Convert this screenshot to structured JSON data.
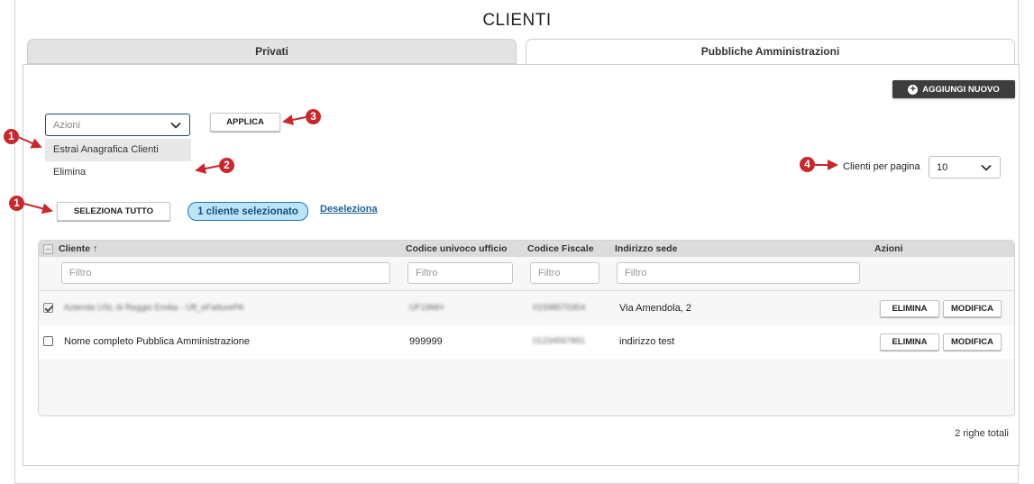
{
  "page": {
    "title": "CLIENTI"
  },
  "tabs": [
    {
      "label": "Privati",
      "active": false
    },
    {
      "label": "Pubbliche Amministrazioni",
      "active": true
    }
  ],
  "toolbar": {
    "add_new_label": "AGGIUNGI NUOVO",
    "add_icon": "plus-circle-icon"
  },
  "actions": {
    "placeholder": "Azioni",
    "options": [
      "Estrai Anagrafica Clienti",
      "Elimina"
    ],
    "apply_label": "APPLICA"
  },
  "selection": {
    "select_all_label": "SELEZIONA TUTTO",
    "selected_badge": "1 cliente selezionato",
    "deselect_label": "Deseleziona"
  },
  "pagination": {
    "per_page_label": "Clienti per pagina",
    "per_page_value": "10",
    "total_label": "2 righe totali"
  },
  "markers": [
    "1",
    "2",
    "3",
    "4",
    "1"
  ],
  "grid": {
    "columns": [
      "Cliente ↑",
      "Codice univoco ufficio",
      "Codice Fiscale",
      "Indirizzo sede",
      "Azioni"
    ],
    "filter_placeholder": "Filtro",
    "rows": [
      {
        "checked": true,
        "cliente": "Azienda USL di Reggio Emilia - Uff_eFatturePA",
        "codice_univoco": "UF19MH",
        "codice_fiscale": "01598570354",
        "indirizzo": "Via Amendola, 2",
        "btn_delete": "ELIMINA",
        "btn_edit": "MODIFICA"
      },
      {
        "checked": false,
        "cliente": "Nome completo Pubblica Amministrazione",
        "codice_univoco": "999999",
        "codice_fiscale": "01234567891",
        "indirizzo": "indirizzo test",
        "btn_delete": "ELIMINA",
        "btn_edit": "MODIFICA"
      }
    ]
  },
  "colors": {
    "accent_dark": "#3d3d3d",
    "badge_bg": "#bde3f7",
    "link": "#1a5f9a",
    "marker": "#c8282c"
  }
}
